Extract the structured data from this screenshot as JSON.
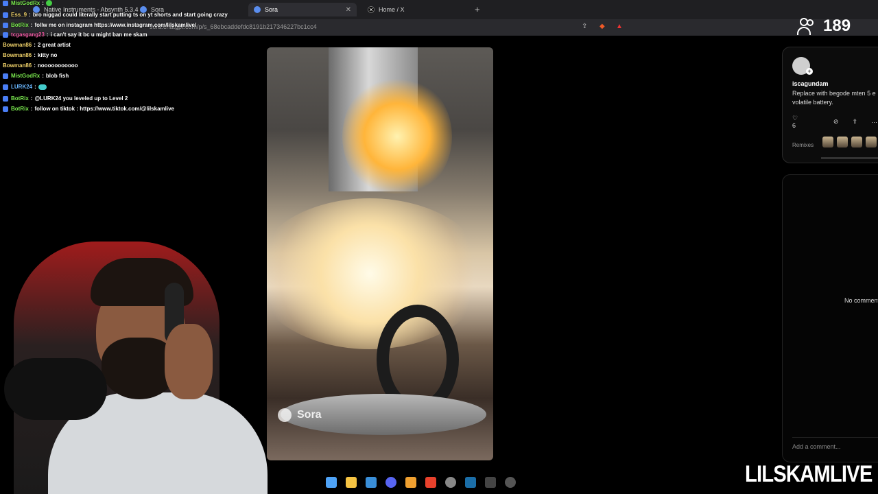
{
  "browser": {
    "tabs": [
      {
        "label": "Native Instruments - Absynth 5.3.4"
      },
      {
        "label": "Sora"
      },
      {
        "label": "Sora",
        "active": true
      },
      {
        "label": "Home / X"
      }
    ],
    "new_tab": "+",
    "url": "sora.chatgpt.com/p/s_68ebcaddefdc8191b217346227bc1cc4"
  },
  "chat": [
    {
      "user": "MistGodRx",
      "text": "",
      "color": "#7bea4f"
    },
    {
      "user": "Ess_9",
      "text": "bro niggad could literally start putting ts on yt shorts and start going crazy",
      "color": "#f0d26a"
    },
    {
      "user": "BotRix",
      "text": "follw me on instagram https://www.instagram.com/lilskamlive/",
      "color": "#7bea4f"
    },
    {
      "user": "tcgasgang23",
      "text": "i can't say it bc u might ban me skam",
      "color": "#f55ba6"
    },
    {
      "user": "Bowman86",
      "text": "2 great artist",
      "color": "#f0d26a"
    },
    {
      "user": "Bowman86",
      "text": "kitty no",
      "color": "#f0d26a"
    },
    {
      "user": "Bowman86",
      "text": "nooooooooooo",
      "color": "#f0d26a"
    },
    {
      "user": "MistGodRx",
      "text": "blob fish",
      "color": "#7bea4f"
    },
    {
      "user": "LURK24",
      "text": "",
      "color": "#6ab7ff"
    },
    {
      "user": "BotRix",
      "text": "@LURK24 you leveled up to Level 2",
      "color": "#7bea4f"
    },
    {
      "user": "BotRix",
      "text": "follow on tiktok : https://www.tiktok.com/@lilskamlive",
      "color": "#7bea4f"
    }
  ],
  "video": {
    "watermark": "Sora"
  },
  "post": {
    "username": "iscagundam",
    "description": "Replace with begode mten 5 e volatile battery.",
    "likes": "6",
    "remixes_label": "Remixes"
  },
  "comments": {
    "empty_text": "No comment",
    "placeholder": "Add a comment..."
  },
  "stream": {
    "viewer_count": "189",
    "brand": "LILSKAMLIVE"
  }
}
